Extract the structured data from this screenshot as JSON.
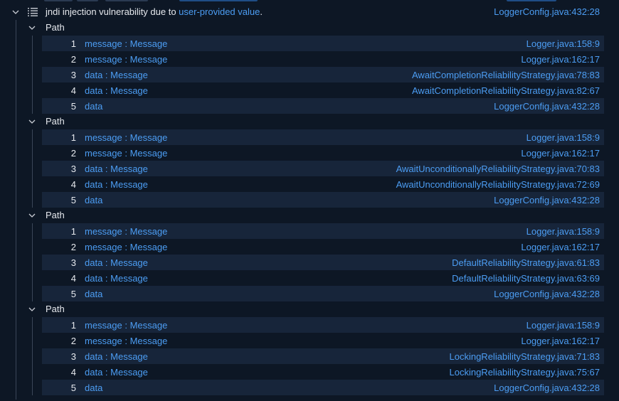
{
  "alert": {
    "title_prefix": "jndi injection vulnerability due to ",
    "title_link": "user-provided value",
    "title_suffix": ".",
    "location": "LoggerConfig.java:432:28"
  },
  "icons": {
    "expand": "chevron-down-icon",
    "list": "list-icon"
  },
  "colors": {
    "background": "#0d1725",
    "row_alt": "#17253a",
    "link": "#4c9df3",
    "text": "#e6e9ee"
  },
  "paths": [
    {
      "label": "Path",
      "steps": [
        {
          "num": "1",
          "label": "message : Message",
          "loc": "Logger.java:158:9"
        },
        {
          "num": "2",
          "label": "message : Message",
          "loc": "Logger.java:162:17"
        },
        {
          "num": "3",
          "label": "data : Message",
          "loc": "AwaitCompletionReliabilityStrategy.java:78:83"
        },
        {
          "num": "4",
          "label": "data : Message",
          "loc": "AwaitCompletionReliabilityStrategy.java:82:67"
        },
        {
          "num": "5",
          "label": "data",
          "loc": "LoggerConfig.java:432:28"
        }
      ]
    },
    {
      "label": "Path",
      "steps": [
        {
          "num": "1",
          "label": "message : Message",
          "loc": "Logger.java:158:9"
        },
        {
          "num": "2",
          "label": "message : Message",
          "loc": "Logger.java:162:17"
        },
        {
          "num": "3",
          "label": "data : Message",
          "loc": "AwaitUnconditionallyReliabilityStrategy.java:70:83"
        },
        {
          "num": "4",
          "label": "data : Message",
          "loc": "AwaitUnconditionallyReliabilityStrategy.java:72:69"
        },
        {
          "num": "5",
          "label": "data",
          "loc": "LoggerConfig.java:432:28"
        }
      ]
    },
    {
      "label": "Path",
      "steps": [
        {
          "num": "1",
          "label": "message : Message",
          "loc": "Logger.java:158:9"
        },
        {
          "num": "2",
          "label": "message : Message",
          "loc": "Logger.java:162:17"
        },
        {
          "num": "3",
          "label": "data : Message",
          "loc": "DefaultReliabilityStrategy.java:61:83"
        },
        {
          "num": "4",
          "label": "data : Message",
          "loc": "DefaultReliabilityStrategy.java:63:69"
        },
        {
          "num": "5",
          "label": "data",
          "loc": "LoggerConfig.java:432:28"
        }
      ]
    },
    {
      "label": "Path",
      "steps": [
        {
          "num": "1",
          "label": "message : Message",
          "loc": "Logger.java:158:9"
        },
        {
          "num": "2",
          "label": "message : Message",
          "loc": "Logger.java:162:17"
        },
        {
          "num": "3",
          "label": "data : Message",
          "loc": "LockingReliabilityStrategy.java:71:83"
        },
        {
          "num": "4",
          "label": "data : Message",
          "loc": "LockingReliabilityStrategy.java:75:67"
        },
        {
          "num": "5",
          "label": "data",
          "loc": "LoggerConfig.java:432:28"
        }
      ]
    }
  ]
}
